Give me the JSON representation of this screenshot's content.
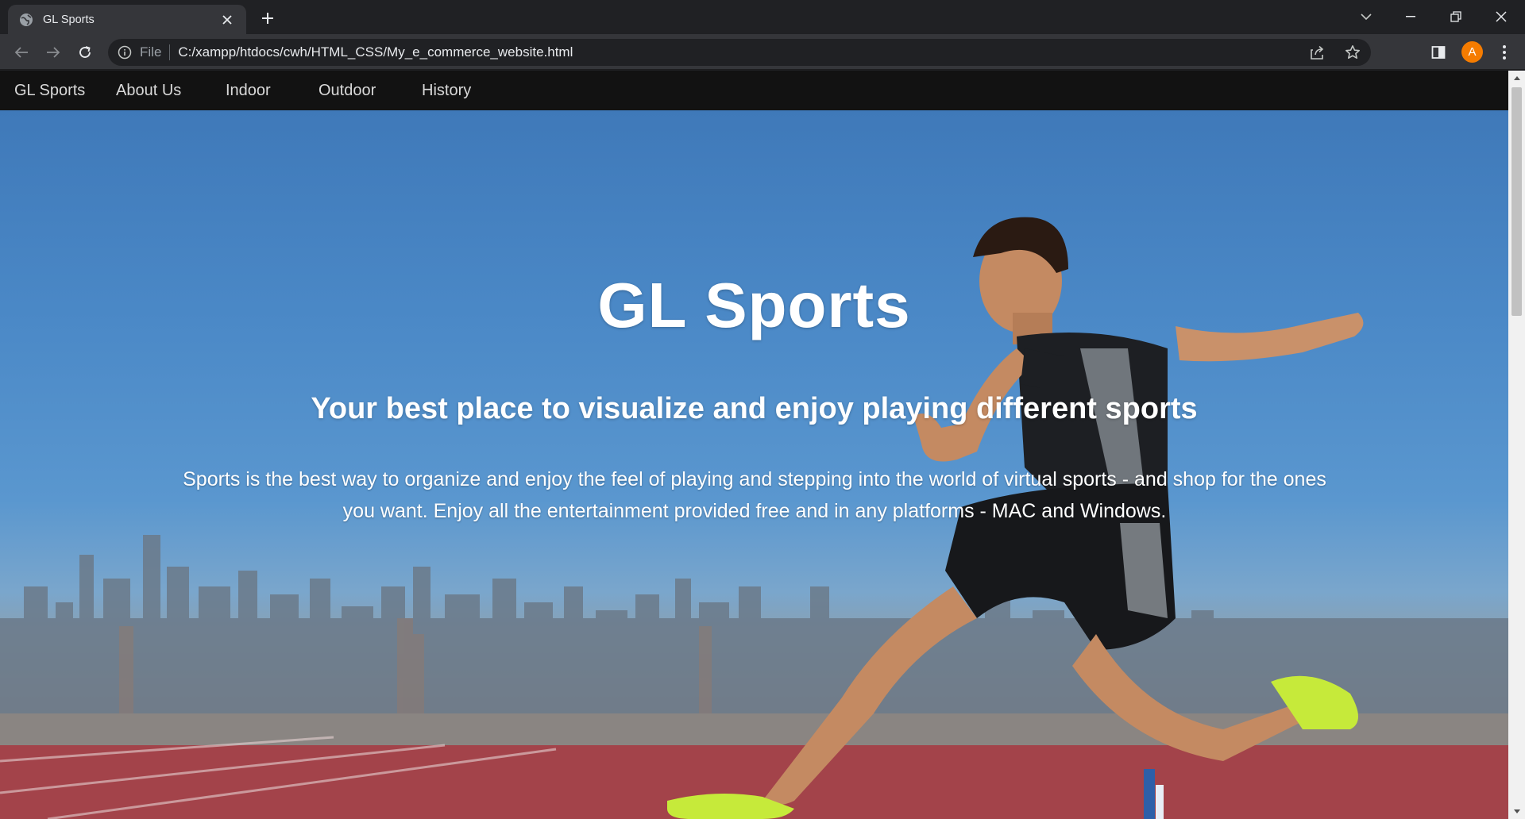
{
  "browser": {
    "tab_title": "GL Sports",
    "omnibox": {
      "scheme_label": "File",
      "url": "C:/xampp/htdocs/cwh/HTML_CSS/My_e_commerce_website.html"
    },
    "profile_initial": "A",
    "icons": {
      "tab": "globe-icon",
      "close": "close-icon",
      "new_tab": "plus-icon",
      "tab_search": "chevron-down-icon",
      "minimize": "minimize-icon",
      "restore": "restore-icon",
      "close_window": "close-icon",
      "back": "back-arrow-icon",
      "forward": "forward-arrow-icon",
      "reload": "reload-icon",
      "site_info": "info-icon",
      "share": "share-icon",
      "bookmark": "star-icon",
      "side_panel": "side-panel-icon",
      "menu": "kebab-menu-icon"
    },
    "colors": {
      "avatar": "#f57c00"
    }
  },
  "site": {
    "nav": {
      "brand": "GL Sports",
      "links": [
        "About Us",
        "Indoor",
        "Outdoor",
        "History"
      ]
    },
    "hero": {
      "title": "GL Sports",
      "subtitle": "Your best place to visualize and enjoy playing different sports",
      "text": "Sports is the best way to organize and enjoy the feel of playing and stepping into the world of virtual sports - and shop for the ones you want. Enjoy all the entertainment provided free and in any platforms - MAC and Windows."
    }
  }
}
